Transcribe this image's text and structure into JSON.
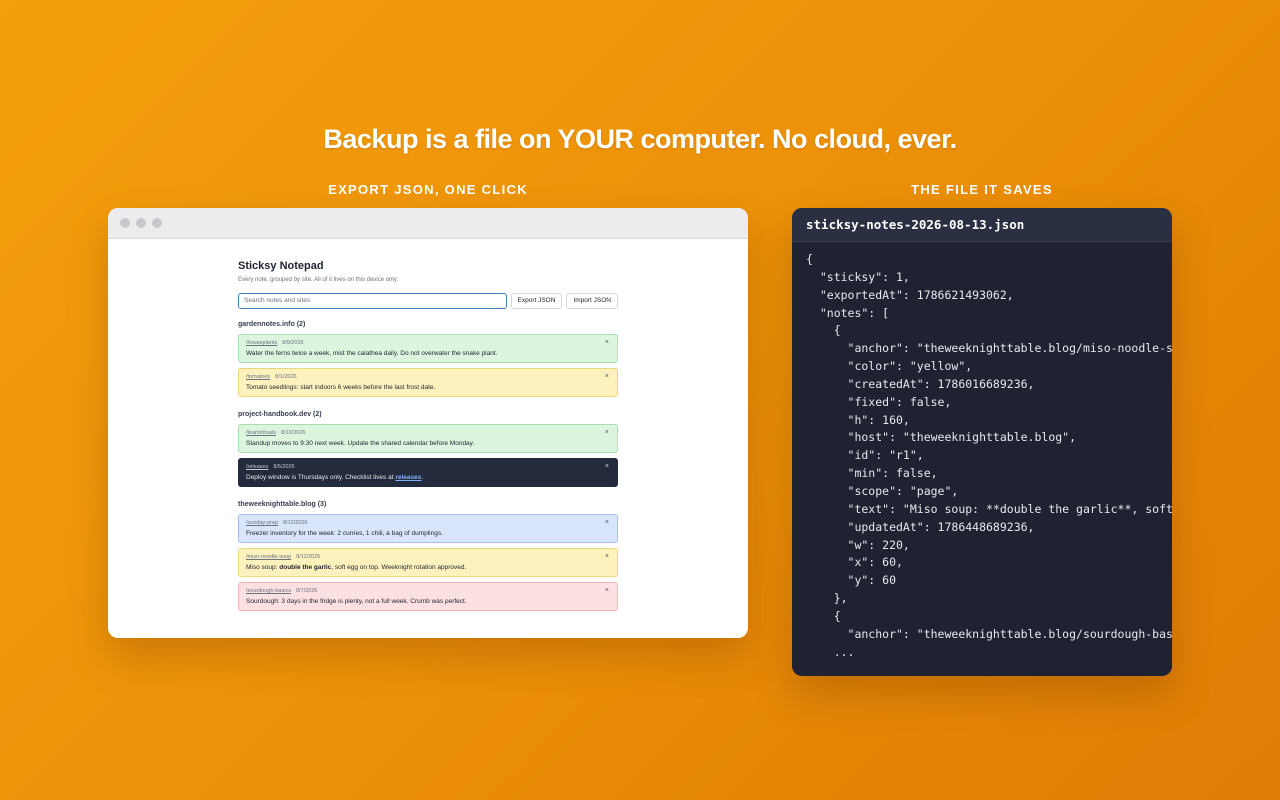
{
  "headline": "Backup is a file on YOUR computer. No cloud, ever.",
  "captions": {
    "left": "EXPORT JSON, ONE CLICK",
    "right": "THE FILE IT SAVES"
  },
  "app": {
    "title": "Sticksy Notepad",
    "subtitle": "Every note, grouped by site. All of it lives on this device only.",
    "search_placeholder": "Search notes and sites",
    "export_label": "Export JSON",
    "import_label": "Import JSON",
    "close_glyph": "×",
    "groups": [
      {
        "title": "gardennotes.info (2)",
        "notes": [
          {
            "path": "/houseplants",
            "date": "8/9/2026",
            "text": "Water the ferns twice a week, mist the calathea daily. Do not overwater the snake plant."
          },
          {
            "path": "/tomatoes",
            "date": "8/1/2026",
            "text": "Tomato seedlings: start indoors 6 weeks before the last frost date."
          }
        ]
      },
      {
        "title": "project-handbook.dev (2)",
        "notes": [
          {
            "path": "/team/rituals",
            "date": "8/10/2026",
            "text": "Standup moves to 9:30 next week. Update the shared calendar before Monday."
          },
          {
            "path": "/releases",
            "date": "8/5/2026",
            "text_before": "Deploy window is Thursdays only. Checklist lives at ",
            "link": "releases",
            "text_after": "."
          }
        ]
      },
      {
        "title": "theweeknighttable.blog (3)",
        "notes": [
          {
            "path": "/sunday-prep",
            "date": "8/12/2026",
            "text": "Freezer inventory for the week: 2 curries, 1 chili, a bag of dumplings."
          },
          {
            "path": "/miso-noodle-soup",
            "date": "8/11/2026",
            "text_before": "Miso soup: ",
            "bold": "double the garlic",
            "text_after": ", soft egg on top. Weeknight rotation approved."
          },
          {
            "path": "/sourdough-basics",
            "date": "8/7/2026",
            "text": "Sourdough: 3 days in the fridge is plenty, not a full week. Crumb was perfect."
          }
        ]
      }
    ]
  },
  "file": {
    "name": "sticksy-notes-2026-08-13.json",
    "lines": [
      "{",
      "  \"sticksy\": 1,",
      "  \"exportedAt\": 1786621493062,",
      "  \"notes\": [",
      "    {",
      "      \"anchor\": \"theweeknighttable.blog/miso-noodle-s",
      "      \"color\": \"yellow\",",
      "      \"createdAt\": 1786016689236,",
      "      \"fixed\": false,",
      "      \"h\": 160,",
      "      \"host\": \"theweeknighttable.blog\",",
      "      \"id\": \"r1\",",
      "      \"min\": false,",
      "      \"scope\": \"page\",",
      "      \"text\": \"Miso soup: **double the garlic**, soft",
      "      \"updatedAt\": 1786448689236,",
      "      \"w\": 220,",
      "      \"x\": 60,",
      "      \"y\": 60",
      "    },",
      "    {",
      "      \"anchor\": \"theweeknighttable.blog/sourdough-bas",
      "    ..."
    ]
  }
}
